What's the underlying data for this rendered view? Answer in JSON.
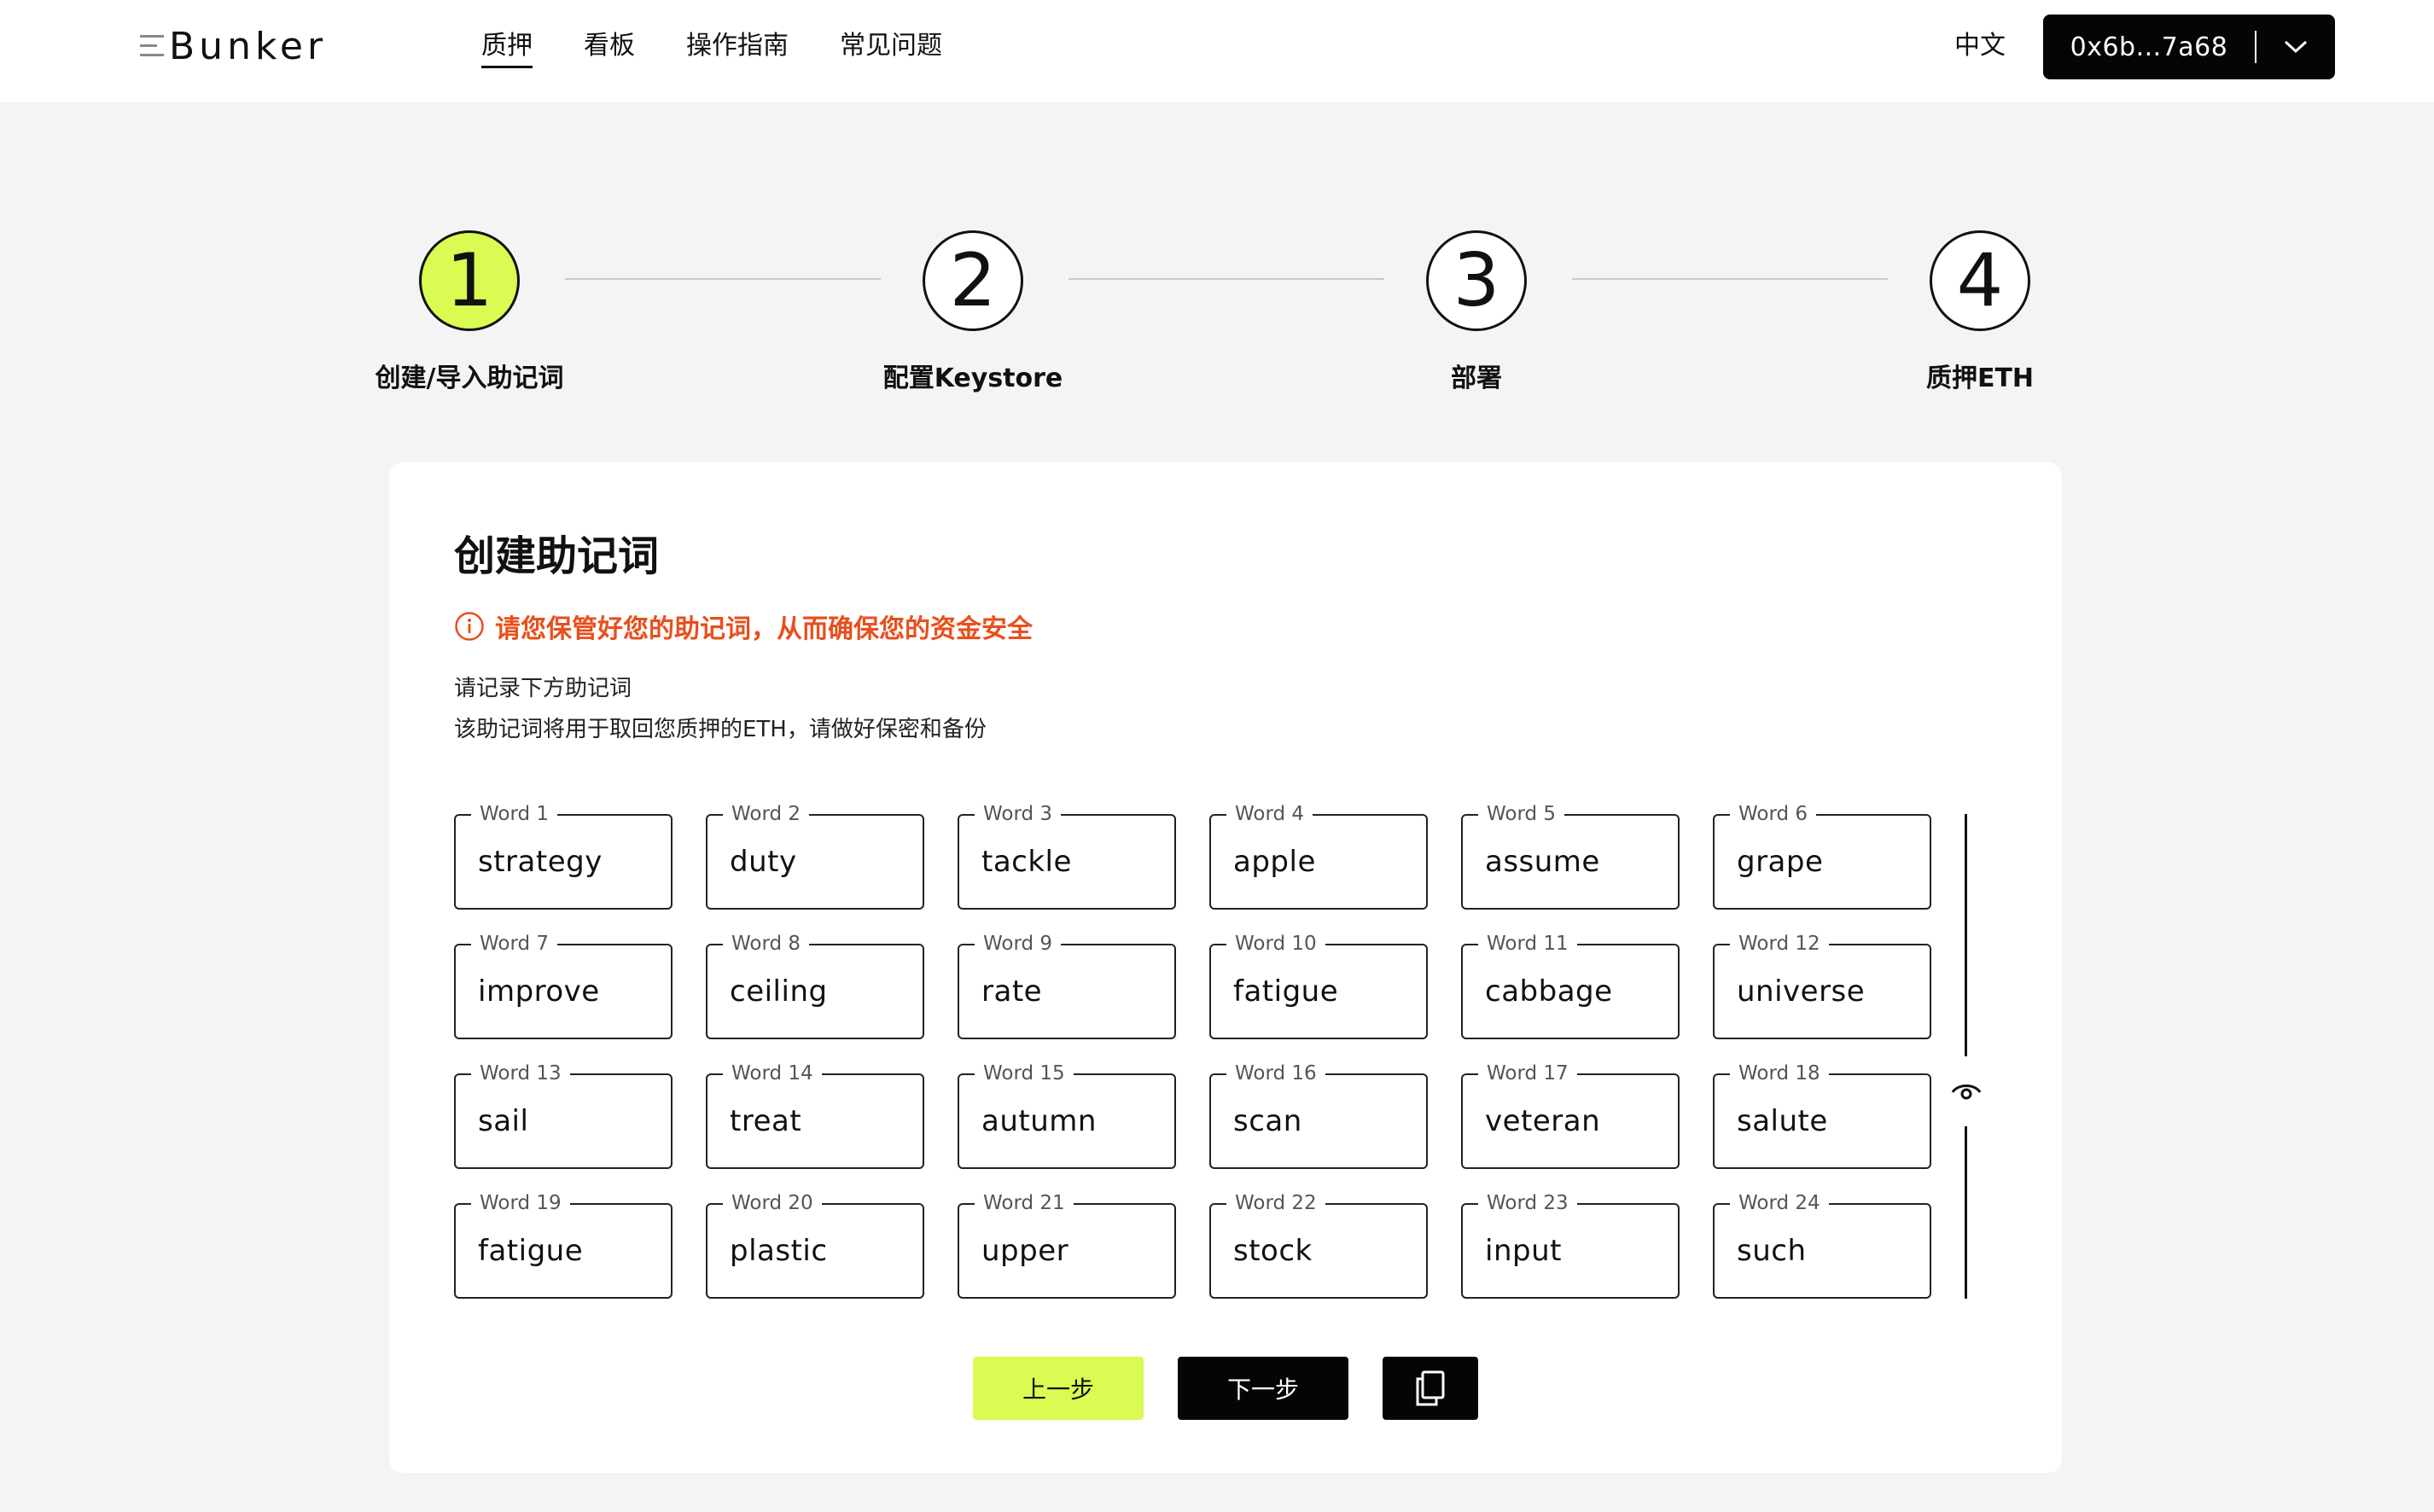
{
  "header": {
    "logo_text": "Bunker",
    "nav": [
      "质押",
      "看板",
      "操作指南",
      "常见问题"
    ],
    "active_nav": "质押",
    "language": "中文",
    "wallet_address": "0x6b...7a68"
  },
  "stepper": {
    "steps": [
      {
        "number": "1",
        "label": "创建/导入助记词",
        "active": true
      },
      {
        "number": "2",
        "label": "配置Keystore",
        "active": false
      },
      {
        "number": "3",
        "label": "部署",
        "active": false
      },
      {
        "number": "4",
        "label": "质押ETH",
        "active": false
      }
    ]
  },
  "card": {
    "title": "创建助记词",
    "warning": "请您保管好您的助记词，从而确保您的资金安全",
    "desc_line1": "请记录下方助记词",
    "desc_line2": "该助记词将用于取回您质押的ETH，请做好保密和备份",
    "words": [
      {
        "label": "Word 1",
        "value": "strategy"
      },
      {
        "label": "Word 2",
        "value": "duty"
      },
      {
        "label": "Word 3",
        "value": "tackle"
      },
      {
        "label": "Word 4",
        "value": "apple"
      },
      {
        "label": "Word 5",
        "value": "assume"
      },
      {
        "label": "Word 6",
        "value": "grape"
      },
      {
        "label": "Word 7",
        "value": "improve"
      },
      {
        "label": "Word 8",
        "value": "ceiling"
      },
      {
        "label": "Word 9",
        "value": "rate"
      },
      {
        "label": "Word 10",
        "value": "fatigue"
      },
      {
        "label": "Word 11",
        "value": "cabbage"
      },
      {
        "label": "Word 12",
        "value": "universe"
      },
      {
        "label": "Word 13",
        "value": "sail"
      },
      {
        "label": "Word 14",
        "value": "treat"
      },
      {
        "label": "Word 15",
        "value": "autumn"
      },
      {
        "label": "Word 16",
        "value": "scan"
      },
      {
        "label": "Word 17",
        "value": "veteran"
      },
      {
        "label": "Word 18",
        "value": "salute"
      },
      {
        "label": "Word 19",
        "value": "fatigue"
      },
      {
        "label": "Word 20",
        "value": "plastic"
      },
      {
        "label": "Word 21",
        "value": "upper"
      },
      {
        "label": "Word 22",
        "value": "stock"
      },
      {
        "label": "Word 23",
        "value": "input"
      },
      {
        "label": "Word 24",
        "value": "such"
      }
    ],
    "prev_label": "上一步",
    "next_label": "下一步"
  },
  "colors": {
    "accent": "#d9fb52",
    "warning": "#e84f1c",
    "dark": "#050505",
    "background": "#f4f4f4"
  },
  "icons": [
    "warning-circle-icon",
    "eye-icon",
    "copy-icon",
    "chevron-down-icon",
    "menu-lines-icon"
  ]
}
